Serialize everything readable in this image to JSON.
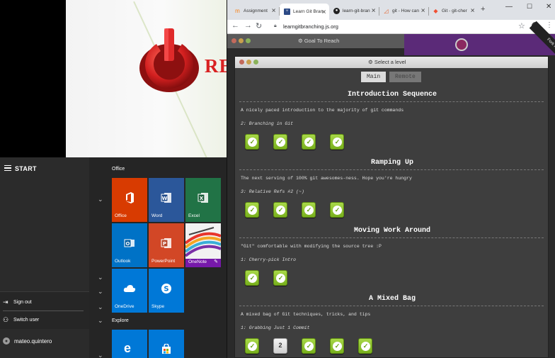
{
  "background": {
    "logo_text": "RE"
  },
  "start_menu": {
    "title": "START",
    "power": {
      "sign_out": "Sign out",
      "switch_user": "Switch user"
    },
    "user_name": "mateo.quintero",
    "groups": {
      "office": "Office",
      "explore": "Explore"
    },
    "tiles": [
      {
        "name": "Office",
        "color": "#d83b01"
      },
      {
        "name": "Word",
        "color": "#2b579a"
      },
      {
        "name": "Excel",
        "color": "#217346"
      },
      {
        "name": "Outlook",
        "color": "#0072c6"
      },
      {
        "name": "PowerPoint",
        "color": "#d24726"
      },
      {
        "name": "OneNote",
        "color": "#7719aa"
      },
      {
        "name": "OneDrive",
        "color": "#0078d7"
      },
      {
        "name": "Skype",
        "color": "#0078d7"
      }
    ]
  },
  "browser": {
    "tabs": [
      {
        "title": "Assignment",
        "icon": "moodle-icon"
      },
      {
        "title": "Learn Git Bran",
        "icon": "branch-icon"
      },
      {
        "title": "learn-git-bran",
        "icon": "github-icon"
      },
      {
        "title": "git - How can",
        "icon": "git-icon"
      },
      {
        "title": "Git - git-cher",
        "icon": "git-scm-icon"
      }
    ],
    "url": "learngitbranching.js.org"
  },
  "page": {
    "goal_bar": "Goal To Reach",
    "fork_ribbon": "Fork me",
    "dialog_title": "Select a level",
    "tabs": {
      "main": "Main",
      "remote": "Remote"
    },
    "sequences": [
      {
        "title": "Introduction Sequence",
        "description": "A nicely paced introduction to the majority of git commands",
        "current": "2: Branching in Git",
        "levels": [
          "done",
          "done",
          "done",
          "done"
        ]
      },
      {
        "title": "Ramping Up",
        "description": "The next serving of 100% git awesomes-ness. Hope you're hungry",
        "current": "3: Relative Refs #2 (~)",
        "levels": [
          "done",
          "done",
          "done",
          "done"
        ]
      },
      {
        "title": "Moving Work Around",
        "description": "\"Git\" comfortable with modifying the source tree :P",
        "current": "1: Cherry-pick Intro",
        "levels": [
          "done",
          "done"
        ]
      },
      {
        "title": "A Mixed Bag",
        "description": "A mixed bag of Git techniques, tricks, and tips",
        "current": "1: Grabbing Just 1 Commit",
        "levels": [
          "done",
          "2",
          "done",
          "done",
          "done"
        ]
      }
    ]
  }
}
